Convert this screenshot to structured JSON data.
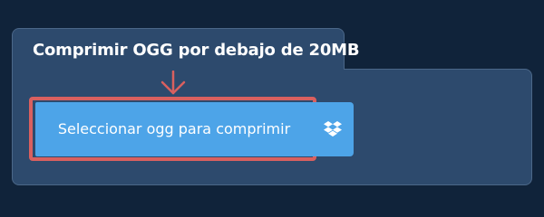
{
  "panel": {
    "tab_title": "Comprimir OGG por debajo de 20MB",
    "select_button_label": "Seleccionar ogg para comprimir",
    "dropbox_icon": "dropbox-icon",
    "arrow_icon": "arrow-down-icon"
  },
  "colors": {
    "background": "#10233a",
    "panel": "#2d4a6d",
    "button": "#4da4e8",
    "highlight": "#d9605f",
    "text": "#ffffff"
  }
}
